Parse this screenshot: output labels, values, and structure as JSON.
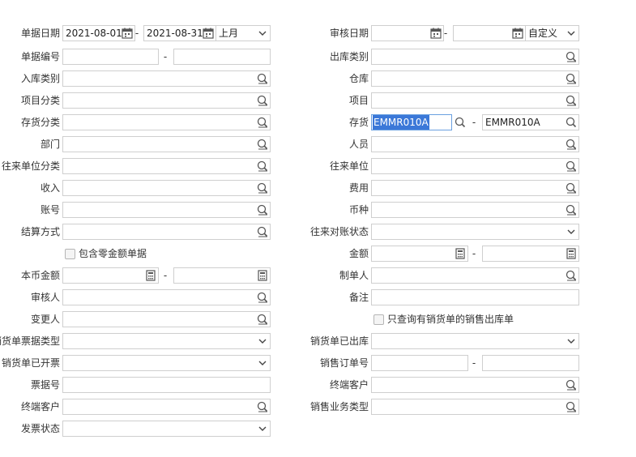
{
  "left": {
    "bill_date": {
      "label": "单据日期",
      "from": "2021-08-01",
      "to": "2021-08-31",
      "period": "上月"
    },
    "bill_no": {
      "label": "单据编号"
    },
    "in_type": {
      "label": "入库类别"
    },
    "project_class": {
      "label": "项目分类"
    },
    "inv_class": {
      "label": "存货分类"
    },
    "dept": {
      "label": "部门"
    },
    "partner_class": {
      "label": "往来单位分类"
    },
    "income": {
      "label": "收入"
    },
    "account": {
      "label": "账号"
    },
    "settle": {
      "label": "结算方式"
    },
    "zero_amount": {
      "label": "包含零金额单据"
    },
    "local_amount": {
      "label": "本币金额"
    },
    "auditor": {
      "label": "审核人"
    },
    "changer": {
      "label": "变更人"
    },
    "sale_doc_type": {
      "label": "销货单票据类型"
    },
    "sale_invoiced": {
      "label": "销货单已开票"
    },
    "ticket_no": {
      "label": "票据号"
    },
    "end_customer": {
      "label": "终端客户"
    },
    "invoice_status": {
      "label": "发票状态"
    }
  },
  "right": {
    "audit_date": {
      "label": "审核日期",
      "period": "自定义"
    },
    "out_type": {
      "label": "出库类别"
    },
    "warehouse": {
      "label": "仓库"
    },
    "project": {
      "label": "项目"
    },
    "inventory": {
      "label": "存货",
      "from": "EMMR010A",
      "to": "EMMR010A"
    },
    "person": {
      "label": "人员"
    },
    "partner": {
      "label": "往来单位"
    },
    "expense": {
      "label": "费用"
    },
    "currency": {
      "label": "币种"
    },
    "reconcile": {
      "label": "往来对账状态"
    },
    "amount": {
      "label": "金额"
    },
    "maker": {
      "label": "制单人"
    },
    "remark": {
      "label": "备注"
    },
    "only_sales": {
      "label": "只查询有销货单的销售出库单"
    },
    "sale_shipped": {
      "label": "销货单已出库"
    },
    "sale_order_no": {
      "label": "销售订单号"
    },
    "end_customer": {
      "label": "终端客户"
    },
    "biz_type": {
      "label": "销售业务类型"
    }
  },
  "range_sep": "-",
  "icons": {
    "ref": "magnifier-icon",
    "cal": "calendar-icon",
    "calc": "calculator-icon",
    "drop": "chevron-down-icon"
  }
}
